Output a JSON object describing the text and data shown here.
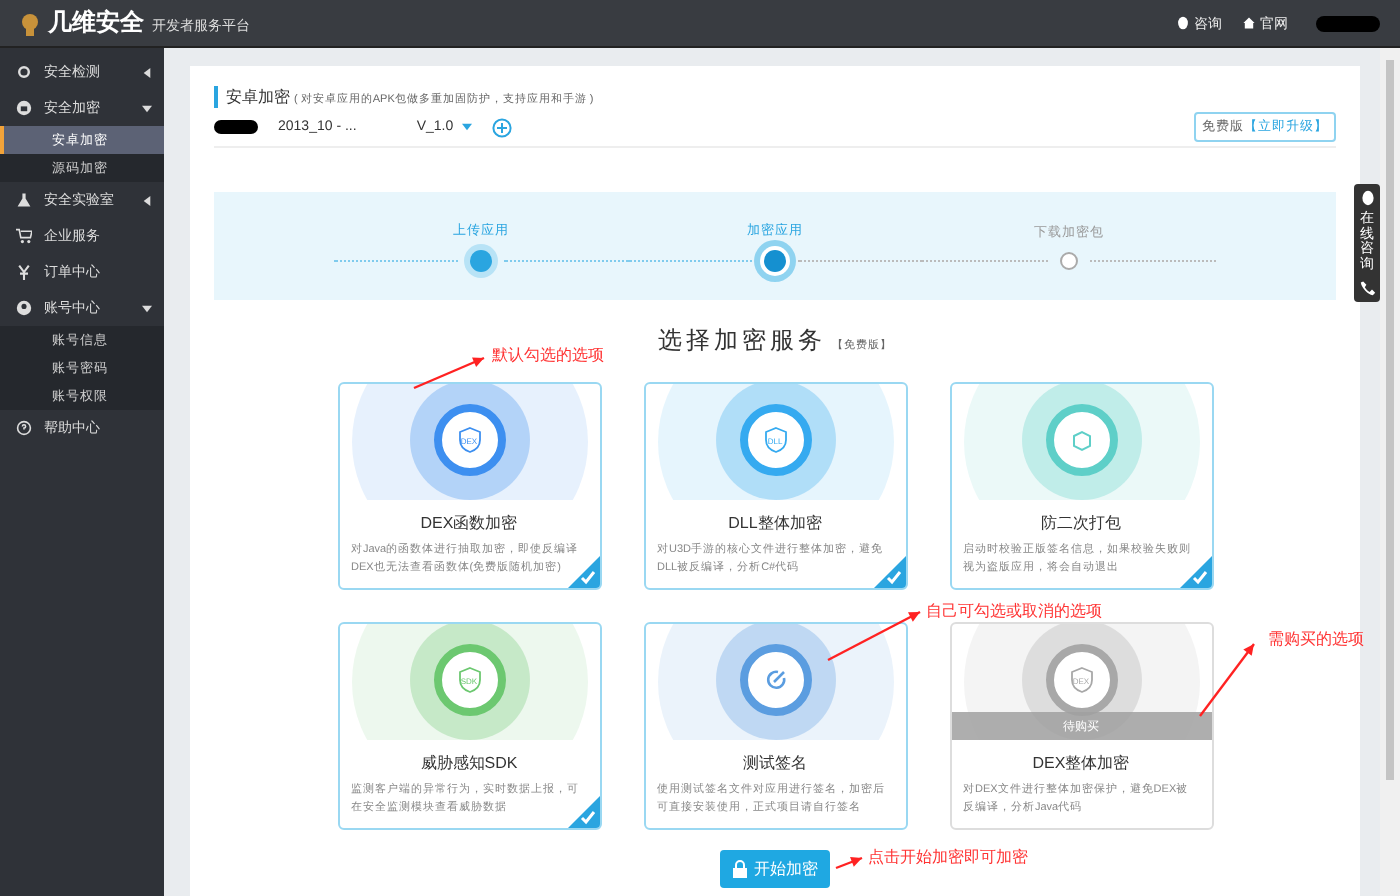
{
  "topbar": {
    "logo": "几维安全",
    "subtitle": "开发者服务平台",
    "links": [
      {
        "label": "咨询"
      },
      {
        "label": "官网"
      }
    ]
  },
  "sidebar": {
    "items": [
      {
        "label": "安全检测",
        "expanded": false
      },
      {
        "label": "安全加密",
        "expanded": true,
        "children": [
          {
            "label": "安卓加密",
            "selected": true
          },
          {
            "label": "源码加密",
            "selected": false
          }
        ]
      },
      {
        "label": "安全实验室",
        "expanded": false
      },
      {
        "label": "企业服务"
      },
      {
        "label": "订单中心"
      },
      {
        "label": "账号中心",
        "expanded": true,
        "children": [
          {
            "label": "账号信息",
            "selected": false
          },
          {
            "label": "账号密码",
            "selected": false
          },
          {
            "label": "账号权限",
            "selected": false
          }
        ]
      },
      {
        "label": "帮助中心"
      }
    ]
  },
  "header": {
    "title": "安卓加密",
    "note": "( 对安卓应用的APK包做多重加固防护，支持应用和手游 )",
    "app": "2013_10 - ...",
    "version": "V_1.0",
    "plan": "免费版",
    "upgrade": "【立即升级】"
  },
  "steps": [
    {
      "label": "上传应用",
      "completed": true,
      "selected": false
    },
    {
      "label": "加密应用",
      "completed": false,
      "selected": true
    },
    {
      "label": "下载加密包",
      "completed": false,
      "selected": false
    }
  ],
  "section": {
    "title": "选择加密服务",
    "tag": "【免费版】"
  },
  "cards": [
    {
      "title": "DEX函数加密",
      "desc": "对Java的函数体进行抽取加密，即使反编译DEX也无法查看函数体(免费版随机加密)",
      "badge": "DEX",
      "color": "#3d8ff0",
      "checked": true,
      "kind": "option"
    },
    {
      "title": "DLL整体加密",
      "desc": "对U3D手游的核心文件进行整体加密，避免DLL被反编译，分析C#代码",
      "badge": "DLL",
      "color": "#35aaf0",
      "checked": true,
      "kind": "option"
    },
    {
      "title": "防二次打包",
      "desc": "启动时校验正版签名信息，如果校验失败则视为盗版应用，将会自动退出",
      "color": "#5ecfc8",
      "checked": true,
      "kind": "option"
    },
    {
      "title": "威胁感知SDK",
      "desc": "监测客户端的异常行为，实时数据上报，可在安全监测模块查看威胁数据",
      "badge": "SDK",
      "color": "#6cc870",
      "checked": true,
      "kind": "option"
    },
    {
      "title": "测试签名",
      "desc": "使用测试签名文件对应用进行签名，加密后可直接安装使用，正式项目请自行签名",
      "color": "#5b9de0",
      "checked": false,
      "kind": "option"
    },
    {
      "title": "DEX整体加密",
      "desc": "对DEX文件进行整体加密保护，避免DEX被反编译，分析Java代码",
      "badge": "DEX",
      "color": "#a8a8a8",
      "checked": false,
      "kind": "locked",
      "overlay": "待购买"
    }
  ],
  "start_button": "开始加密",
  "annotations": [
    "默认勾选的选项",
    "自己可勾选或取消的选项",
    "需购买的选项",
    "点击开始加密即可加密"
  ],
  "side_widget": {
    "label": "在线咨询"
  }
}
